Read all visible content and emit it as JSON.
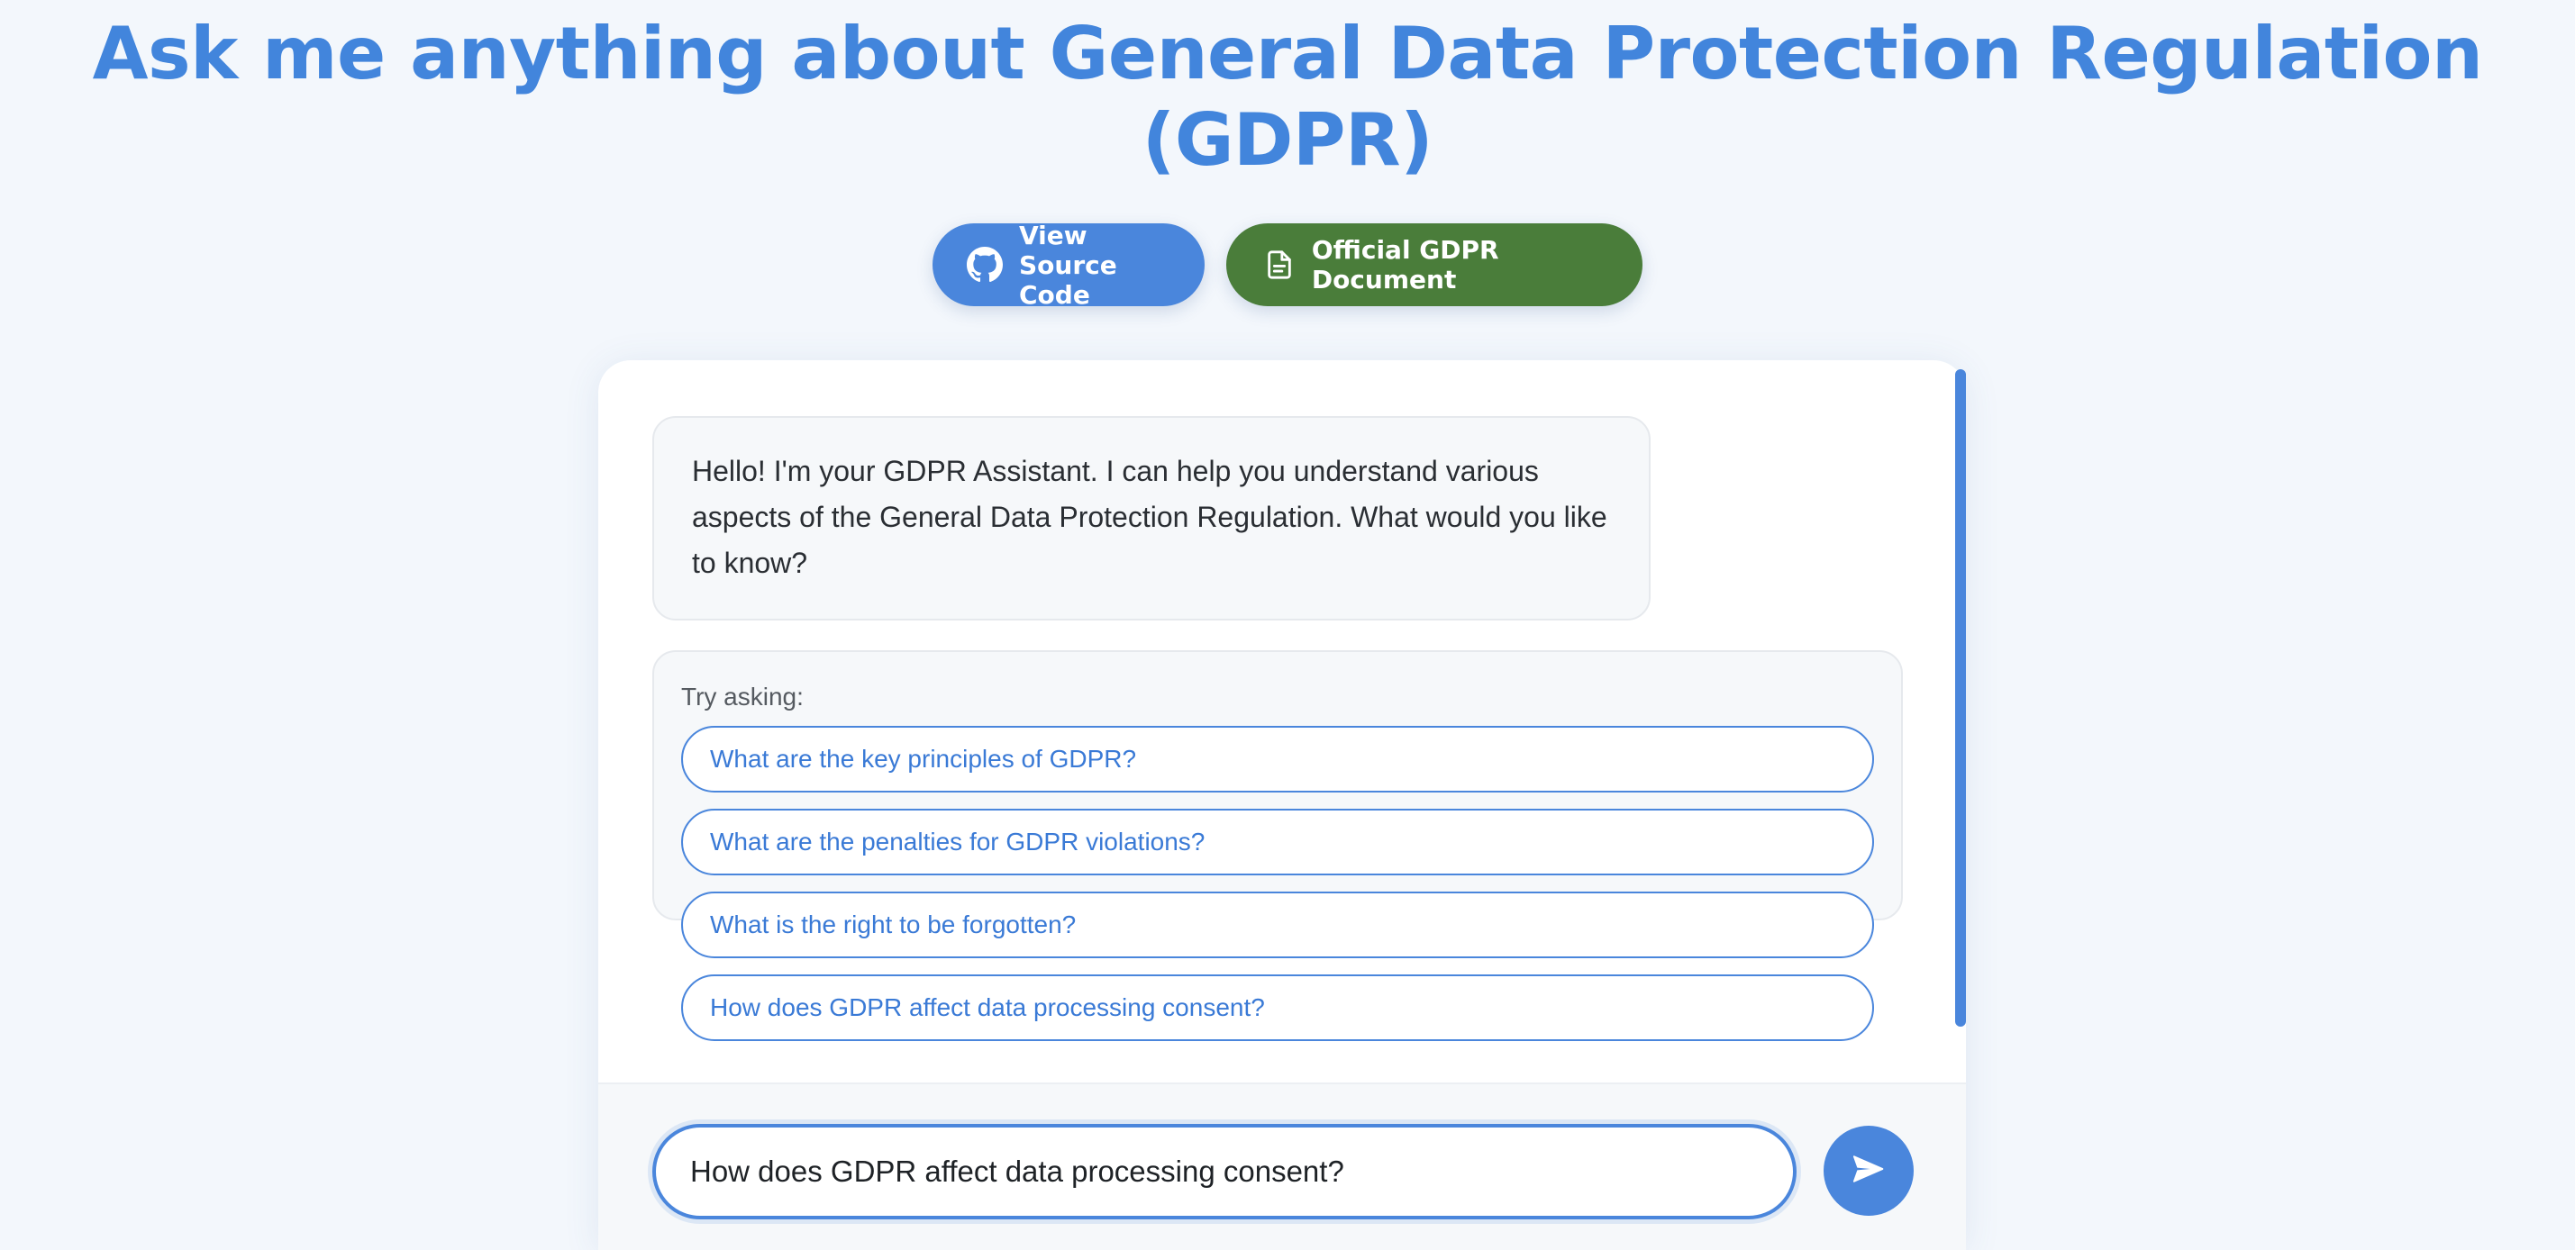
{
  "header": {
    "title": "Ask me anything about General Data Protection Regulation (GDPR)",
    "buttons": [
      {
        "label": "View Source Code",
        "icon": "github-icon",
        "color": "#4a86dc"
      },
      {
        "label": "Official GDPR Document",
        "icon": "document-icon",
        "color": "#4a7d3a"
      }
    ]
  },
  "chat": {
    "messages": [
      {
        "role": "assistant",
        "text": "Hello! I'm your GDPR Assistant. I can help you understand various aspects of the General Data Protection Regulation. What would you like to know?"
      }
    ],
    "suggestions_label": "Try asking:",
    "suggestions": [
      "What are the key principles of GDPR?",
      "What are the penalties for GDPR violations?",
      "What is the right to be forgotten?",
      "How does GDPR affect data processing consent?"
    ]
  },
  "composer": {
    "value": "How does GDPR affect data processing consent?",
    "send_icon": "send-icon"
  },
  "colors": {
    "accent": "#4a86dc",
    "title": "#4285dc",
    "document_button": "#4a7d3a",
    "background": "#f3f7fc"
  }
}
